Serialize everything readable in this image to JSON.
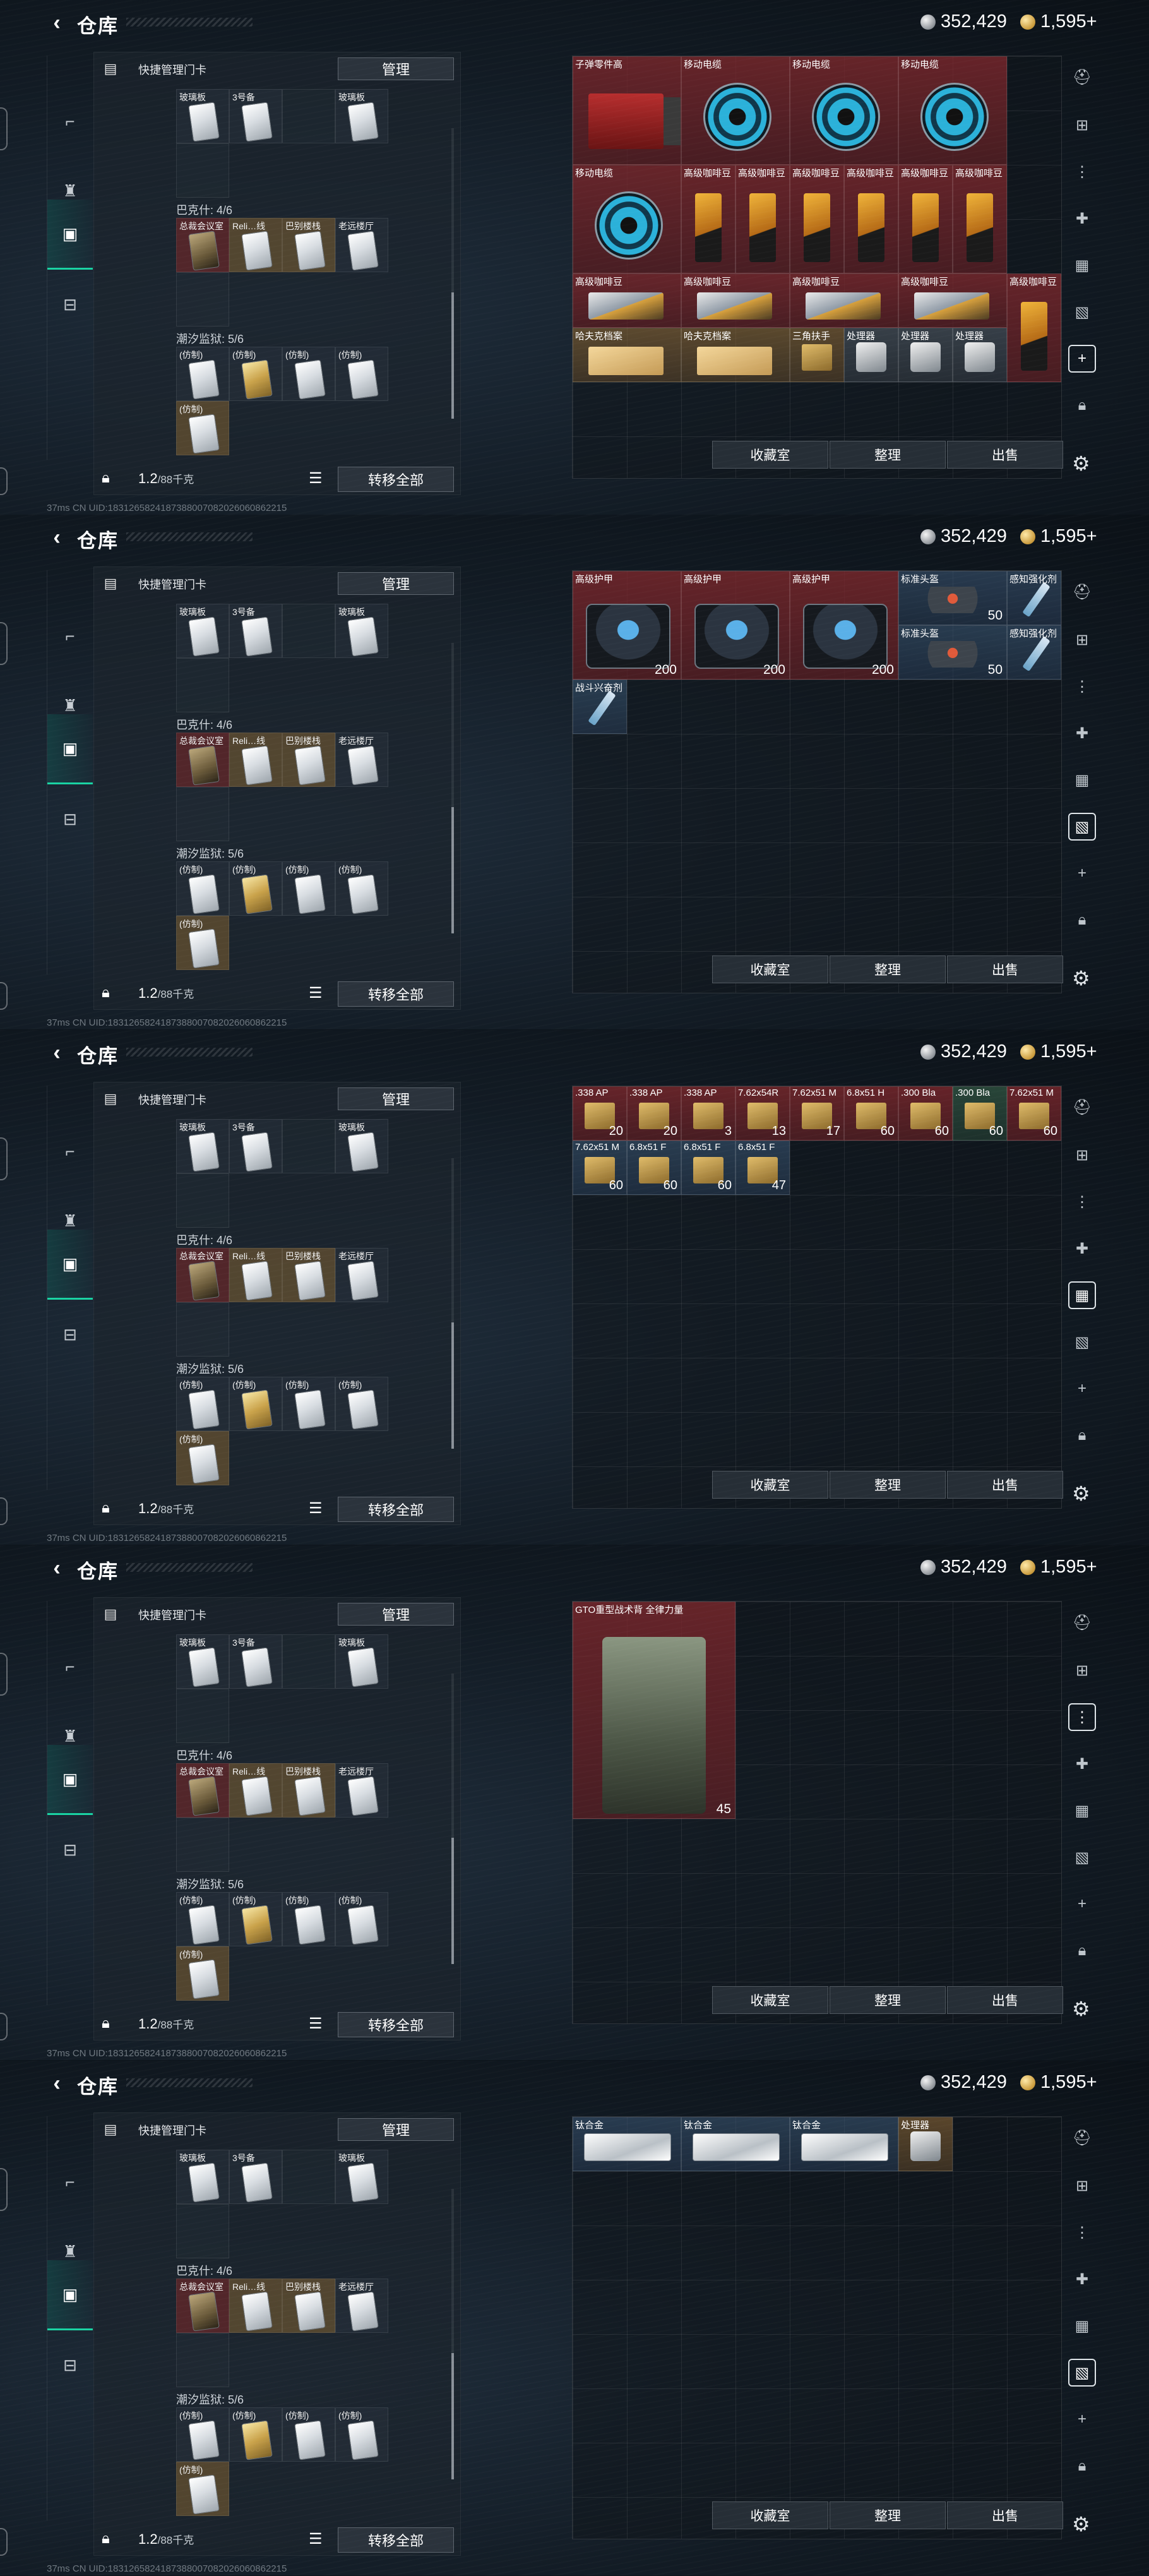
{
  "header": {
    "title": "仓库",
    "silver": "352,429",
    "gold": "1,595+"
  },
  "left_panel": {
    "title": "快捷管理门卡",
    "manage_label": "管理",
    "groups": [
      {
        "label": "",
        "items": [
          "玻璃板",
          "3号备",
          "",
          "玻璃板"
        ]
      },
      {
        "label": "巴克什: 4/6",
        "items": [
          "总裁会议室",
          "Reli…线",
          "巴别楼栈",
          "老远楼厅"
        ]
      },
      {
        "label": "潮汐监狱: 5/6",
        "items": [
          "(仿制)",
          "(仿制)",
          "(仿制)",
          "(仿制)",
          "(仿制)"
        ]
      }
    ],
    "weight": "1.2",
    "weight_unit": "/88千克",
    "transfer_all_label": "转移全部"
  },
  "bottom_buttons": {
    "collection": "收藏室",
    "organize": "整理",
    "sell": "出售"
  },
  "status_line": "37ms    CN UID:1831265824187388007082026060862215",
  "screens": [
    {
      "items": [
        {
          "name": "子弹零件高",
          "style": "red",
          "art": "toolbox",
          "c": 0,
          "r": 0,
          "w": 2,
          "h": 2
        },
        {
          "name": "移动电缆",
          "style": "red",
          "art": "reel",
          "c": 2,
          "r": 0,
          "w": 2,
          "h": 2
        },
        {
          "name": "移动电缆",
          "style": "red",
          "art": "reel",
          "c": 4,
          "r": 0,
          "w": 2,
          "h": 2
        },
        {
          "name": "移动电缆",
          "style": "red",
          "art": "reel",
          "c": 6,
          "r": 0,
          "w": 2,
          "h": 2
        },
        {
          "name": "移动电缆",
          "style": "red",
          "art": "reel",
          "c": 0,
          "r": 2,
          "w": 2,
          "h": 2
        },
        {
          "name": "高级咖啡豆",
          "style": "red",
          "art": "bag",
          "c": 2,
          "r": 2,
          "w": 1,
          "h": 2
        },
        {
          "name": "高级咖啡豆",
          "style": "red",
          "art": "bag",
          "c": 3,
          "r": 2,
          "w": 1,
          "h": 2
        },
        {
          "name": "高级咖啡豆",
          "style": "red",
          "art": "bag",
          "c": 4,
          "r": 2,
          "w": 1,
          "h": 2
        },
        {
          "name": "高级咖啡豆",
          "style": "red",
          "art": "bag",
          "c": 5,
          "r": 2,
          "w": 1,
          "h": 2
        },
        {
          "name": "高级咖啡豆",
          "style": "red",
          "art": "bag",
          "c": 6,
          "r": 2,
          "w": 1,
          "h": 2
        },
        {
          "name": "高级咖啡豆",
          "style": "red",
          "art": "bag",
          "c": 7,
          "r": 2,
          "w": 1,
          "h": 2
        },
        {
          "name": "高级咖啡豆",
          "style": "red",
          "art": "crate",
          "c": 0,
          "r": 4,
          "w": 2,
          "h": 1
        },
        {
          "name": "高级咖啡豆",
          "style": "red",
          "art": "crate",
          "c": 2,
          "r": 4,
          "w": 2,
          "h": 1
        },
        {
          "name": "高级咖啡豆",
          "style": "red",
          "art": "crate",
          "c": 4,
          "r": 4,
          "w": 2,
          "h": 1
        },
        {
          "name": "高级咖啡豆",
          "style": "red",
          "art": "crate",
          "c": 6,
          "r": 4,
          "w": 2,
          "h": 1
        },
        {
          "name": "高级咖啡豆",
          "style": "red",
          "art": "bag",
          "c": 8,
          "r": 4,
          "w": 1,
          "h": 2
        },
        {
          "name": "哈夫克档案",
          "style": "gold",
          "art": "folder",
          "c": 0,
          "r": 5,
          "w": 2,
          "h": 1
        },
        {
          "name": "哈夫克档案",
          "style": "gold",
          "art": "folder",
          "c": 2,
          "r": 5,
          "w": 2,
          "h": 1
        },
        {
          "name": "三角扶手",
          "style": "gold",
          "art": "ammo",
          "c": 4,
          "r": 5,
          "w": 1,
          "h": 1
        },
        {
          "name": "处理器",
          "style": "grey",
          "art": "radio",
          "c": 5,
          "r": 5,
          "w": 1,
          "h": 1
        },
        {
          "name": "处理器",
          "style": "grey",
          "art": "radio",
          "c": 6,
          "r": 5,
          "w": 1,
          "h": 1
        },
        {
          "name": "处理器",
          "style": "grey",
          "art": "radio",
          "c": 7,
          "r": 5,
          "w": 1,
          "h": 1
        }
      ],
      "active_rail": 6
    },
    {
      "items": [
        {
          "name": "高级护甲",
          "style": "red",
          "art": "armor",
          "c": 0,
          "r": 0,
          "w": 2,
          "h": 2,
          "dur": "200"
        },
        {
          "name": "高级护甲",
          "style": "red",
          "art": "armor",
          "c": 2,
          "r": 0,
          "w": 2,
          "h": 2,
          "dur": "200"
        },
        {
          "name": "高级护甲",
          "style": "red",
          "art": "armor",
          "c": 4,
          "r": 0,
          "w": 2,
          "h": 2,
          "dur": "200"
        },
        {
          "name": "标准头盔",
          "style": "blue",
          "art": "helmet",
          "c": 6,
          "r": 0,
          "w": 2,
          "h": 1,
          "dur": "50"
        },
        {
          "name": "感知强化剂",
          "style": "blue",
          "art": "syringe",
          "c": 8,
          "r": 0,
          "w": 1,
          "h": 1
        },
        {
          "name": "标准头盔",
          "style": "blue",
          "art": "helmet",
          "c": 6,
          "r": 1,
          "w": 2,
          "h": 1,
          "dur": "50"
        },
        {
          "name": "感知强化剂",
          "style": "blue",
          "art": "syringe",
          "c": 8,
          "r": 1,
          "w": 1,
          "h": 1
        },
        {
          "name": "战斗兴奋剂",
          "style": "blue",
          "art": "syringe",
          "c": 0,
          "r": 2,
          "w": 1,
          "h": 1
        }
      ],
      "active_rail": 5
    },
    {
      "items": [
        {
          "name": ".338 AP",
          "style": "red",
          "art": "ammo",
          "c": 0,
          "r": 0,
          "w": 1,
          "h": 1,
          "qty": "20"
        },
        {
          "name": ".338 AP",
          "style": "red",
          "art": "ammo",
          "c": 1,
          "r": 0,
          "w": 1,
          "h": 1,
          "qty": "20"
        },
        {
          "name": ".338 AP",
          "style": "red",
          "art": "ammo",
          "c": 2,
          "r": 0,
          "w": 1,
          "h": 1,
          "qty": "3"
        },
        {
          "name": "7.62x54R",
          "style": "red",
          "art": "ammo",
          "c": 3,
          "r": 0,
          "w": 1,
          "h": 1,
          "qty": "13"
        },
        {
          "name": "7.62x51 M",
          "style": "red",
          "art": "ammo",
          "c": 4,
          "r": 0,
          "w": 1,
          "h": 1,
          "qty": "17"
        },
        {
          "name": "6.8x51 H",
          "style": "red",
          "art": "ammo",
          "c": 5,
          "r": 0,
          "w": 1,
          "h": 1,
          "qty": "60"
        },
        {
          "name": ".300 Bla",
          "style": "red",
          "art": "ammo",
          "c": 6,
          "r": 0,
          "w": 1,
          "h": 1,
          "qty": "60"
        },
        {
          "name": ".300 Bla",
          "style": "green",
          "art": "ammo",
          "c": 7,
          "r": 0,
          "w": 1,
          "h": 1,
          "qty": "60"
        },
        {
          "name": "7.62x51 M",
          "style": "red",
          "art": "ammo",
          "c": 8,
          "r": 0,
          "w": 1,
          "h": 1,
          "qty": "60"
        },
        {
          "name": "7.62x51 M",
          "style": "blue",
          "art": "ammo",
          "c": 0,
          "r": 1,
          "w": 1,
          "h": 1,
          "qty": "60"
        },
        {
          "name": "6.8x51 F",
          "style": "blue",
          "art": "ammo",
          "c": 1,
          "r": 1,
          "w": 1,
          "h": 1,
          "qty": "60"
        },
        {
          "name": "6.8x51 F",
          "style": "blue",
          "art": "ammo",
          "c": 2,
          "r": 1,
          "w": 1,
          "h": 1,
          "qty": "60"
        },
        {
          "name": "6.8x51 F",
          "style": "blue",
          "art": "ammo",
          "c": 3,
          "r": 1,
          "w": 1,
          "h": 1,
          "qty": "47"
        }
      ],
      "active_rail": 4
    },
    {
      "items": [
        {
          "name": "GTO重型战术背 全律力量",
          "style": "red",
          "art": "rig",
          "c": 0,
          "r": 0,
          "w": 3,
          "h": 4,
          "dur": "45"
        }
      ],
      "active_rail": 2
    },
    {
      "items": [
        {
          "name": "钛合金",
          "style": "blue",
          "art": "plate",
          "c": 0,
          "r": 0,
          "w": 2,
          "h": 1
        },
        {
          "name": "钛合金",
          "style": "blue",
          "art": "plate",
          "c": 2,
          "r": 0,
          "w": 2,
          "h": 1
        },
        {
          "name": "钛合金",
          "style": "blue",
          "art": "plate",
          "c": 4,
          "r": 0,
          "w": 2,
          "h": 1
        },
        {
          "name": "处理器",
          "style": "gold",
          "art": "radio",
          "c": 6,
          "r": 0,
          "w": 1,
          "h": 1
        }
      ],
      "active_rail": 5
    }
  ],
  "icons": {
    "back": "chevron-left-icon",
    "rail": [
      "pistol-icon",
      "armor-icon",
      "backpack-icon",
      "toolbox-icon"
    ],
    "right_rail": [
      "helmet-icon",
      "storage-icon",
      "ammo-icon",
      "medkit-icon",
      "keycard-icon",
      "crate-icon",
      "plus-icon",
      "lock-icon"
    ]
  },
  "colors": {
    "accent": "#19d3a3",
    "rare_red": "#822d32",
    "epic_gold": "#966e37",
    "blue": "#3c5a78"
  }
}
